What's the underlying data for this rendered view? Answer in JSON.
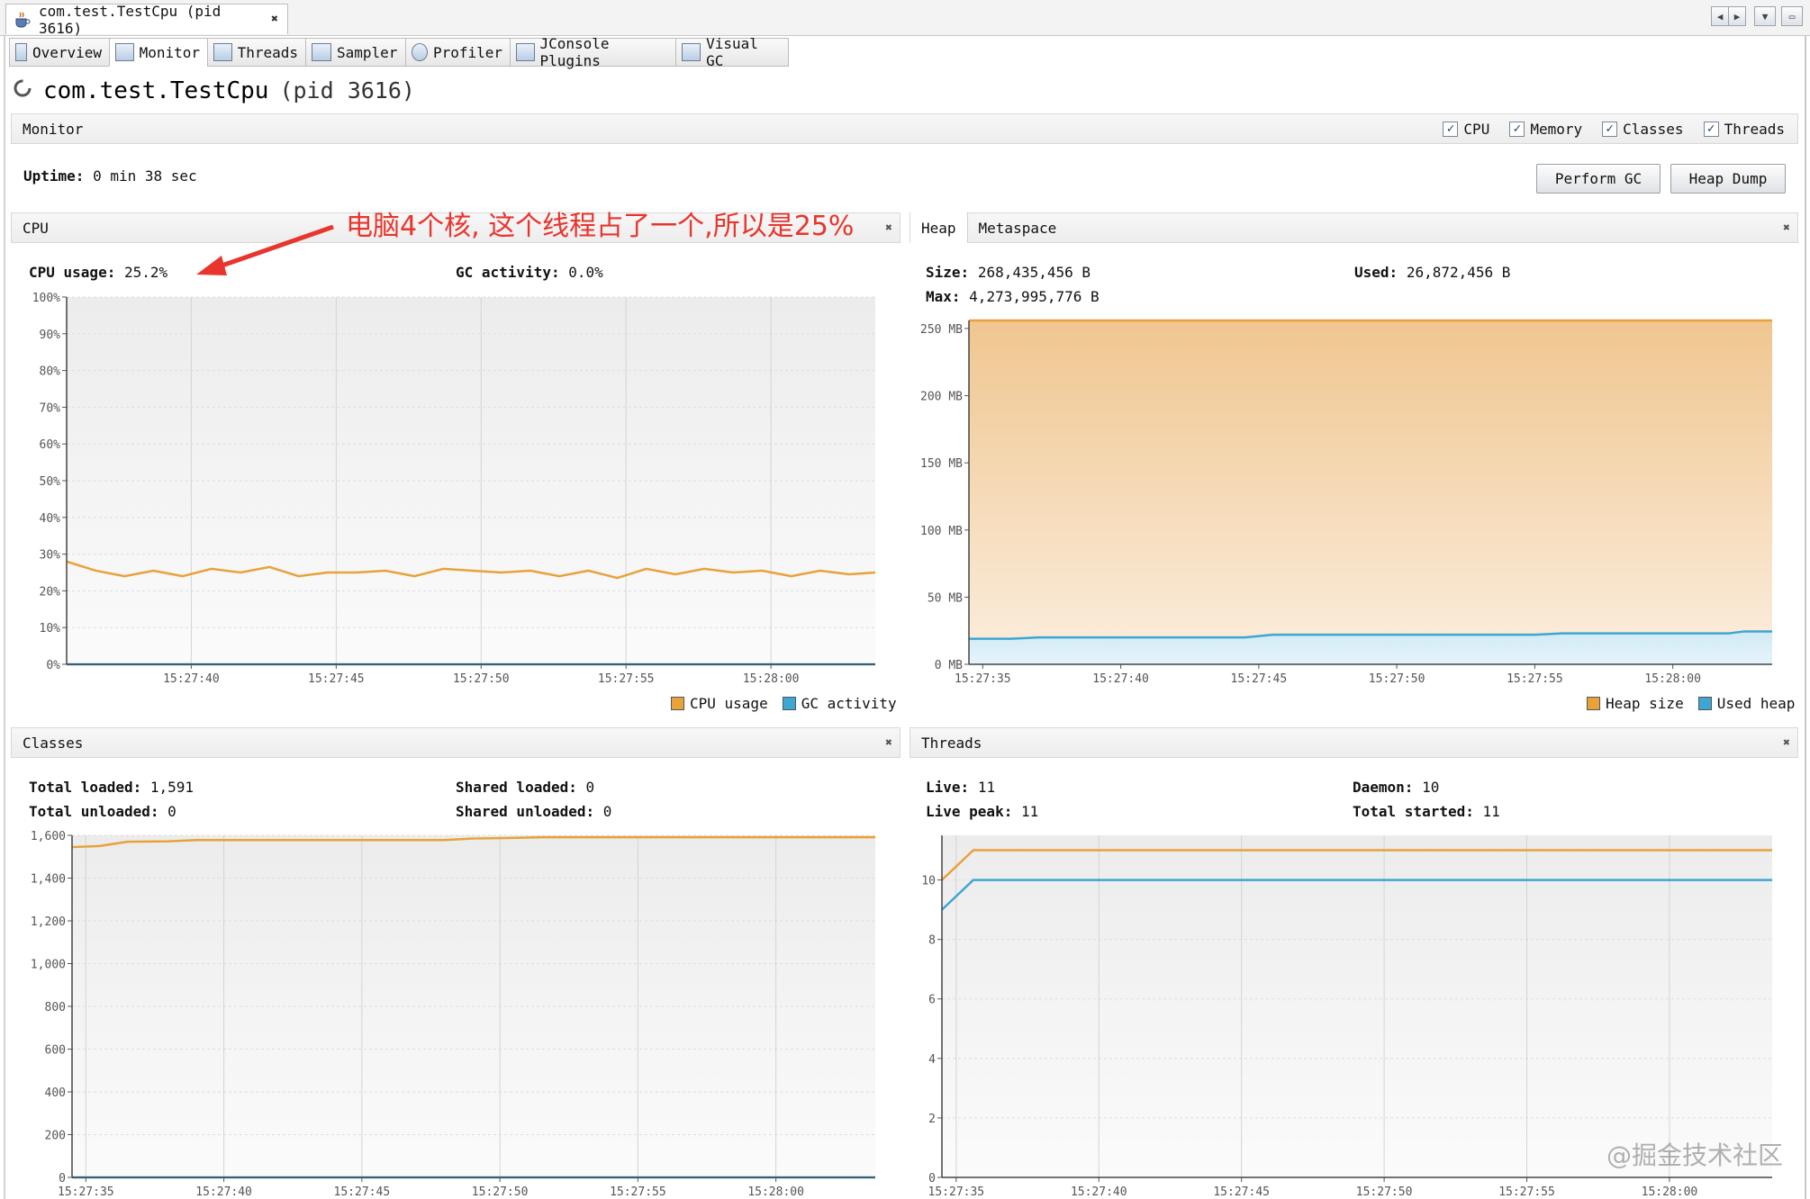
{
  "doc_tab": {
    "label": "com.test.TestCpu (pid 3616)"
  },
  "tabs": [
    {
      "label": "Overview"
    },
    {
      "label": "Monitor"
    },
    {
      "label": "Threads"
    },
    {
      "label": "Sampler"
    },
    {
      "label": "Profiler"
    },
    {
      "label": "JConsole Plugins"
    },
    {
      "label": "Visual GC"
    }
  ],
  "header": {
    "app_name": "com.test.TestCpu",
    "pid": "(pid 3616)"
  },
  "monitor_bar": {
    "label": "Monitor",
    "checkboxes": [
      {
        "label": "CPU",
        "checked": true
      },
      {
        "label": "Memory",
        "checked": true
      },
      {
        "label": "Classes",
        "checked": true
      },
      {
        "label": "Threads",
        "checked": true
      }
    ]
  },
  "uptime": {
    "label": "Uptime:",
    "value": "0 min 38 sec"
  },
  "buttons": {
    "perform_gc": "Perform GC",
    "heap_dump": "Heap Dump"
  },
  "annotation": "电脑4个核, 这个线程占了一个,所以是25%",
  "watermark": "@掘金技术社区",
  "colors": {
    "orange": "#e8a23a",
    "blue": "#3ea6d2",
    "annotation": "#e8352d",
    "heap_fill": "#f0c690"
  },
  "cpu_panel": {
    "title": "CPU",
    "stats": {
      "cpu_usage_label": "CPU usage:",
      "cpu_usage_value": "25.2%",
      "gc_activity_label": "GC activity:",
      "gc_activity_value": "0.0%"
    },
    "legend": [
      "CPU usage",
      "GC activity"
    ]
  },
  "heap_panel": {
    "tabs": [
      "Heap",
      "Metaspace"
    ],
    "stats": {
      "size_label": "Size:",
      "size_value": "268,435,456 B",
      "used_label": "Used:",
      "used_value": "26,872,456 B",
      "max_label": "Max:",
      "max_value": "4,273,995,776 B"
    },
    "legend": [
      "Heap size",
      "Used heap"
    ]
  },
  "classes_panel": {
    "title": "Classes",
    "stats": {
      "total_loaded_label": "Total loaded:",
      "total_loaded_value": "1,591",
      "total_unloaded_label": "Total unloaded:",
      "total_unloaded_value": "0",
      "shared_loaded_label": "Shared loaded:",
      "shared_loaded_value": "0",
      "shared_unloaded_label": "Shared unloaded:",
      "shared_unloaded_value": "0"
    }
  },
  "threads_panel": {
    "title": "Threads",
    "stats": {
      "live_label": "Live:",
      "live_value": "11",
      "live_peak_label": "Live peak:",
      "live_peak_value": "11",
      "daemon_label": "Daemon:",
      "daemon_value": "10",
      "total_started_label": "Total started:",
      "total_started_value": "11"
    }
  },
  "chart_data": [
    {
      "id": "cpu",
      "type": "line",
      "x_unit": "seconds since 15:27:35",
      "yticks": [
        "0%",
        "10%",
        "20%",
        "30%",
        "40%",
        "50%",
        "60%",
        "70%",
        "80%",
        "90%",
        "100%"
      ],
      "ylim": [
        0,
        100
      ],
      "xticks": [
        {
          "label": "15:27:40",
          "x": 5
        },
        {
          "label": "15:27:45",
          "x": 10
        },
        {
          "label": "15:27:50",
          "x": 15
        },
        {
          "label": "15:27:55",
          "x": 20
        },
        {
          "label": "15:28:00",
          "x": 25
        }
      ],
      "xlim": [
        0.7,
        28.6
      ],
      "series": [
        {
          "name": "CPU usage",
          "color": "#e8a23a",
          "fill": false,
          "points": [
            [
              0.7,
              28
            ],
            [
              1.7,
              25.5
            ],
            [
              2.7,
              24
            ],
            [
              3.7,
              25.5
            ],
            [
              4.7,
              24
            ],
            [
              5.7,
              26
            ],
            [
              6.7,
              25
            ],
            [
              7.7,
              26.5
            ],
            [
              8.7,
              24
            ],
            [
              9.7,
              25
            ],
            [
              10.7,
              25
            ],
            [
              11.7,
              25.5
            ],
            [
              12.7,
              24
            ],
            [
              13.7,
              26
            ],
            [
              14.7,
              25.5
            ],
            [
              15.7,
              25
            ],
            [
              16.7,
              25.5
            ],
            [
              17.7,
              24
            ],
            [
              18.7,
              25.5
            ],
            [
              19.7,
              23.5
            ],
            [
              20.7,
              26
            ],
            [
              21.7,
              24.5
            ],
            [
              22.7,
              26
            ],
            [
              23.7,
              25
            ],
            [
              24.7,
              25.5
            ],
            [
              25.7,
              24
            ],
            [
              26.7,
              25.5
            ],
            [
              27.7,
              24.5
            ],
            [
              28.6,
              25
            ]
          ]
        },
        {
          "name": "GC activity",
          "color": "#3ea6d2",
          "fill": false,
          "points": [
            [
              0.7,
              0
            ],
            [
              28.6,
              0
            ]
          ]
        }
      ]
    },
    {
      "id": "heap",
      "type": "area",
      "y_unit": "MB",
      "x_unit": "seconds since 15:27:35",
      "yticks": [
        "0 MB",
        "50 MB",
        "100 MB",
        "150 MB",
        "200 MB",
        "250 MB"
      ],
      "ylim": [
        0,
        256
      ],
      "xticks": [
        {
          "label": "15:27:35",
          "x": 0
        },
        {
          "label": "15:27:40",
          "x": 5
        },
        {
          "label": "15:27:45",
          "x": 10
        },
        {
          "label": "15:27:50",
          "x": 15
        },
        {
          "label": "15:27:55",
          "x": 20
        },
        {
          "label": "15:28:00",
          "x": 25
        }
      ],
      "xlim": [
        -0.5,
        28.6
      ],
      "series": [
        {
          "name": "Heap size",
          "color": "#e8a23a",
          "fill": true,
          "points": [
            [
              -0.5,
              256
            ],
            [
              28.6,
              256
            ]
          ]
        },
        {
          "name": "Used heap",
          "color": "#3ea6d2",
          "fill": true,
          "points": [
            [
              -0.5,
              19
            ],
            [
              1,
              19
            ],
            [
              2,
              20
            ],
            [
              9.5,
              20
            ],
            [
              10.5,
              22
            ],
            [
              20,
              22
            ],
            [
              21,
              23
            ],
            [
              27,
              23
            ],
            [
              27.6,
              24.5
            ],
            [
              28.6,
              24.5
            ]
          ]
        }
      ]
    },
    {
      "id": "classes",
      "type": "line",
      "x_unit": "seconds since 15:27:35",
      "yticks": [
        "0",
        "200",
        "400",
        "600",
        "800",
        "1,000",
        "1,200",
        "1,400",
        "1,600"
      ],
      "ylim": [
        0,
        1600
      ],
      "xticks": [
        {
          "label": "15:27:35",
          "x": 0
        },
        {
          "label": "15:27:40",
          "x": 5
        },
        {
          "label": "15:27:45",
          "x": 10
        },
        {
          "label": "15:27:50",
          "x": 15
        },
        {
          "label": "15:27:55",
          "x": 20
        },
        {
          "label": "15:28:00",
          "x": 25
        }
      ],
      "xlim": [
        -0.5,
        28.6
      ],
      "series": [
        {
          "name": "Total loaded",
          "color": "#e8a23a",
          "fill": false,
          "points": [
            [
              -0.5,
              1545
            ],
            [
              0.5,
              1550
            ],
            [
              1.5,
              1570
            ],
            [
              3,
              1572
            ],
            [
              4,
              1578
            ],
            [
              13,
              1578
            ],
            [
              14,
              1585
            ],
            [
              15.5,
              1588
            ],
            [
              16.5,
              1591
            ],
            [
              28.6,
              1591
            ]
          ]
        },
        {
          "name": "Shared loaded",
          "color": "#3ea6d2",
          "fill": false,
          "points": [
            [
              -0.5,
              0
            ],
            [
              28.6,
              0
            ]
          ]
        }
      ]
    },
    {
      "id": "threads",
      "type": "line",
      "x_unit": "seconds since 15:27:35",
      "yticks": [
        "0",
        "2",
        "4",
        "6",
        "8",
        "10"
      ],
      "ylim": [
        0,
        11.5
      ],
      "xticks": [
        {
          "label": "15:27:35",
          "x": 0
        },
        {
          "label": "15:27:40",
          "x": 5
        },
        {
          "label": "15:27:45",
          "x": 10
        },
        {
          "label": "15:27:50",
          "x": 15
        },
        {
          "label": "15:27:55",
          "x": 20
        },
        {
          "label": "15:28:00",
          "x": 25
        }
      ],
      "xlim": [
        -0.5,
        28.6
      ],
      "series": [
        {
          "name": "Live threads",
          "color": "#e8a23a",
          "fill": false,
          "points": [
            [
              -0.5,
              10
            ],
            [
              0.6,
              11
            ],
            [
              28.6,
              11
            ]
          ]
        },
        {
          "name": "Daemon threads",
          "color": "#3ea6d2",
          "fill": false,
          "points": [
            [
              -0.5,
              9
            ],
            [
              0.6,
              10
            ],
            [
              28.6,
              10
            ]
          ]
        }
      ]
    }
  ]
}
